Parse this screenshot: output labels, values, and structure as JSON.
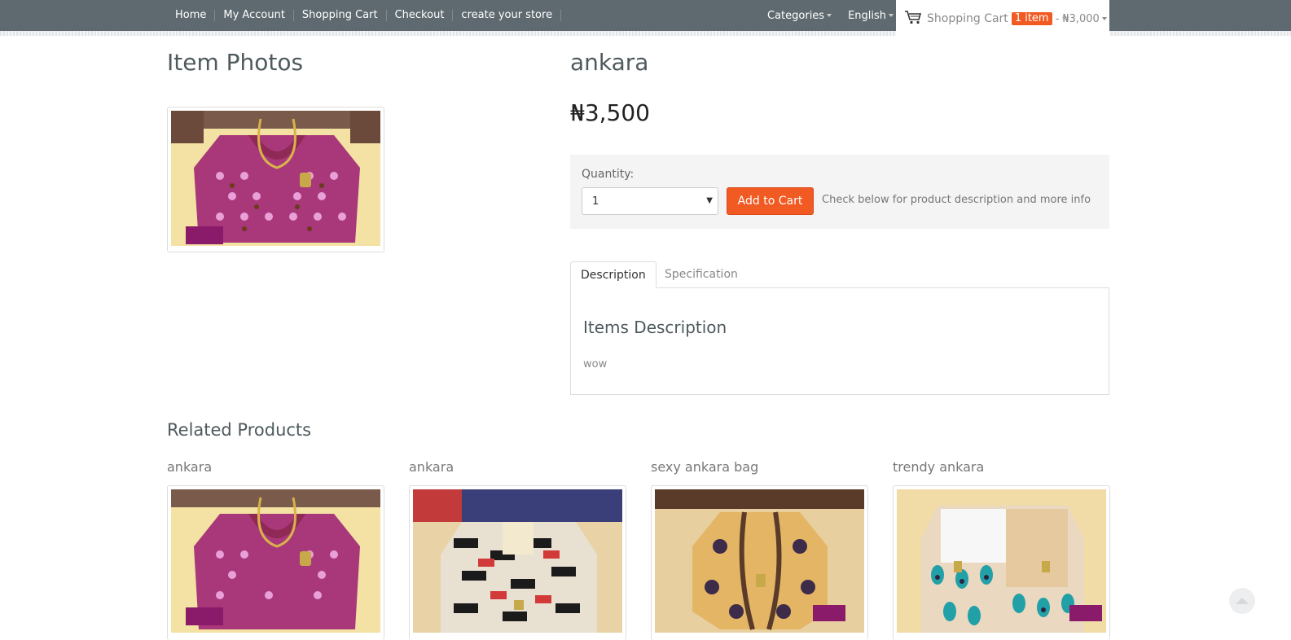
{
  "nav": {
    "links": [
      "Home",
      "My Account",
      "Shopping Cart",
      "Checkout",
      "create your store"
    ],
    "categories": "Categories",
    "language": "English"
  },
  "cart": {
    "icon": "shopping-cart-icon",
    "label": "Shopping Cart",
    "count": "1 item",
    "separator": "-",
    "total": "₦3,000"
  },
  "gallery": {
    "title": "Item Photos"
  },
  "product": {
    "title": "ankara",
    "price": "₦3,500",
    "quantity_label": "Quantity:",
    "quantity_value": "1",
    "add_to_cart": "Add to Cart",
    "hint": "Check below for product description and more info"
  },
  "tabs": {
    "description": "Description",
    "specification": "Specification",
    "panel_title": "Items Description",
    "panel_text": "wow"
  },
  "related": {
    "title": "Related Products",
    "items": [
      {
        "name": "ankara"
      },
      {
        "name": "ankara"
      },
      {
        "name": "sexy ankara bag"
      },
      {
        "name": "trendy ankara"
      }
    ]
  },
  "colors": {
    "accent": "#f15a22",
    "navbar": "#5f6a70"
  }
}
